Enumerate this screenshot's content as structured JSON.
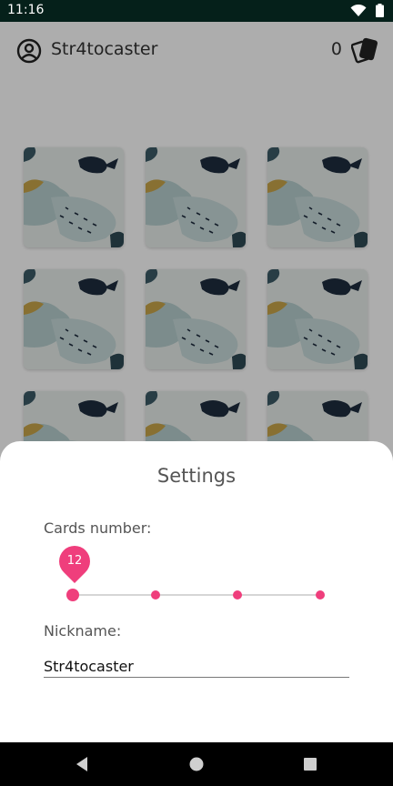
{
  "status_bar": {
    "time": "11:16",
    "icons": [
      "wifi-icon",
      "battery-icon"
    ]
  },
  "app_bar": {
    "username": "Str4tocaster",
    "count": "0",
    "icons": [
      "account-circle-icon",
      "cards-icon"
    ]
  },
  "grid": {
    "cards_visible": 9,
    "card_art": "abstract-painting-back"
  },
  "settings": {
    "title": "Settings",
    "cards_label": "Cards number:",
    "cards_value": "12",
    "cards_stops": 4,
    "cards_selected_index": 0,
    "nickname_label": "Nickname:",
    "nickname_value": "Str4tocaster"
  },
  "nav_bar": {
    "icons": [
      "back-icon",
      "home-icon",
      "recents-icon"
    ]
  },
  "colors": {
    "accent": "#ef3e7c",
    "status_bar": "#05201a"
  }
}
